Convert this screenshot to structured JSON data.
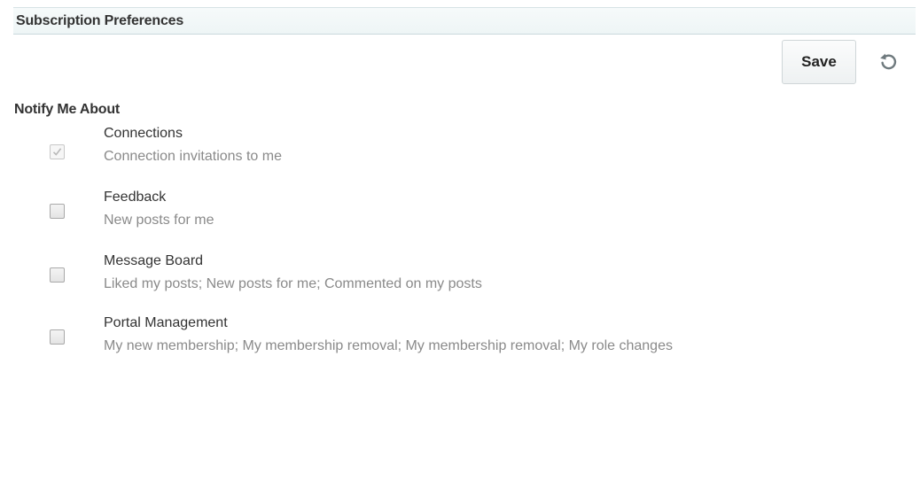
{
  "header": {
    "title": "Subscription Preferences"
  },
  "toolbar": {
    "save_label": "Save",
    "reset_icon": "undo-icon"
  },
  "section": {
    "label": "Notify Me About"
  },
  "preferences": [
    {
      "title": "Connections",
      "description": "Connection invitations to me",
      "checked": true,
      "disabled": true
    },
    {
      "title": "Feedback",
      "description": "New posts for me",
      "checked": false,
      "disabled": false
    },
    {
      "title": "Message Board",
      "description": "Liked my posts; New posts for me; Commented on my posts",
      "checked": false,
      "disabled": false
    },
    {
      "title": "Portal Management",
      "description": "My new membership; My membership removal; My membership removal; My role changes",
      "checked": false,
      "disabled": false
    }
  ],
  "colors": {
    "header_bg": "#eef5f6",
    "text": "#333333",
    "description": "#8a8a8a"
  }
}
